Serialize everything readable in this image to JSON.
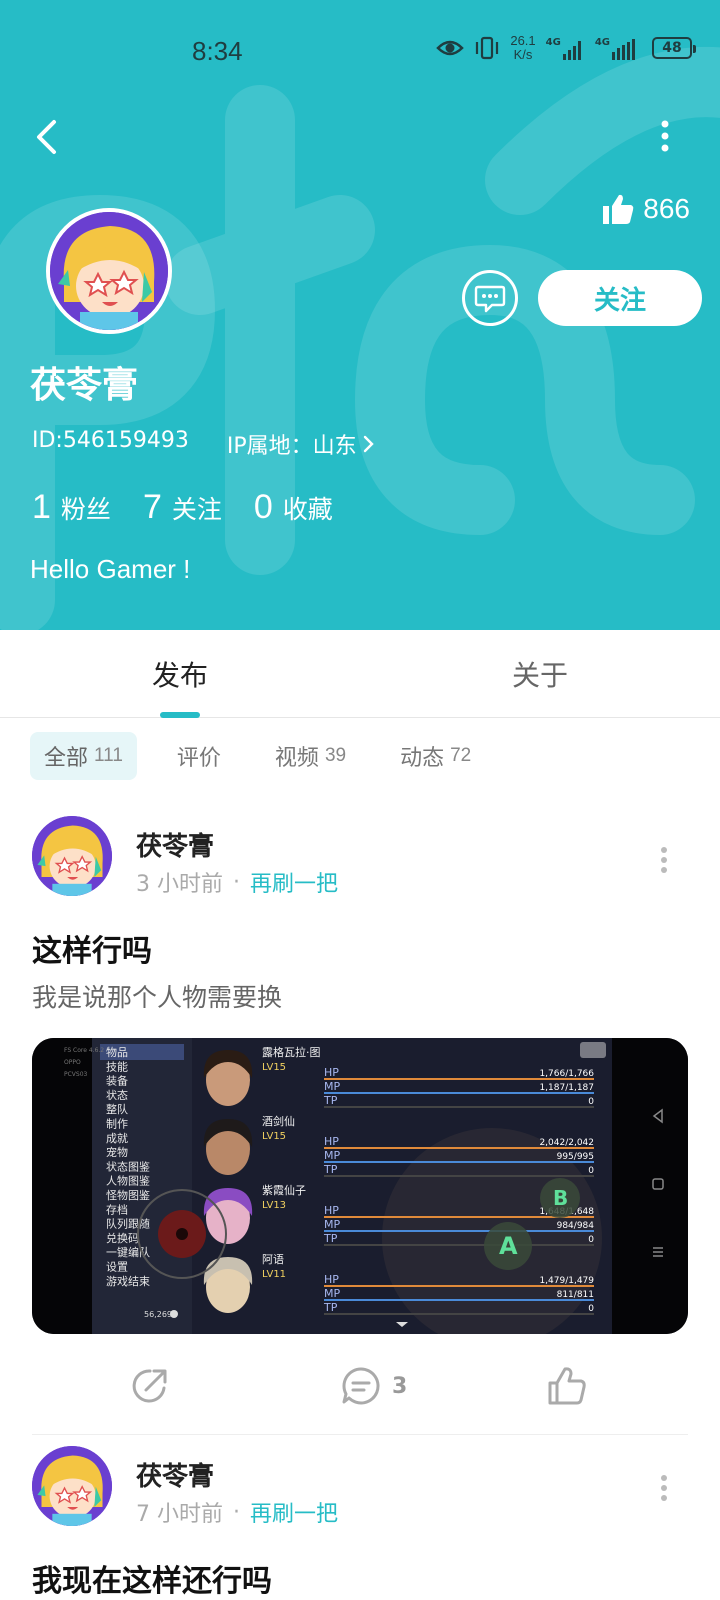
{
  "status_bar": {
    "time": "8:34",
    "speed_value": "26.1",
    "speed_unit": "K/s",
    "net1": "4G",
    "net2": "4G",
    "battery": "48"
  },
  "profile": {
    "likes": "866",
    "follow_label": "关注",
    "name": "茯苓膏",
    "id": "ID:546159493",
    "ip_label": "IP属地：山东",
    "fans_count": "1",
    "fans_label": "粉丝",
    "following_count": "7",
    "following_label": "关注",
    "fav_count": "0",
    "fav_label": "收藏",
    "bio": "Hello Gamer !"
  },
  "tabs": {
    "publish": "发布",
    "about": "关于"
  },
  "filters": [
    {
      "label": "全部",
      "count": "111"
    },
    {
      "label": "评价",
      "count": ""
    },
    {
      "label": "视频",
      "count": "39"
    },
    {
      "label": "动态",
      "count": "72"
    }
  ],
  "posts": [
    {
      "author": "茯苓膏",
      "time": "3 小时前",
      "game": "再刷一把",
      "title": "这样行吗",
      "body": "我是说那个人物需要换",
      "comments": "3"
    },
    {
      "author": "茯苓膏",
      "time": "7 小时前",
      "game": "再刷一把",
      "title": "我现在这样还行吗"
    }
  ],
  "game_screenshot": {
    "menu": [
      "物品",
      "技能",
      "装备",
      "状态",
      "整队",
      "制作",
      "成就",
      "宠物",
      "状态图鉴",
      "人物图鉴",
      "怪物图鉴",
      "存档",
      "队列跟随",
      "兑换码",
      "一键编队",
      "设置",
      "游戏结束"
    ],
    "gold": "56,269",
    "characters": [
      {
        "name": "露格瓦拉·图",
        "level": "LV15",
        "hp": "1,766/1,766",
        "mp": "1,187/1,187",
        "tp": "0",
        "hp_frac": 1.0,
        "mp_frac": 1.0
      },
      {
        "name": "酒剑仙",
        "level": "LV15",
        "hp": "2,042/2,042",
        "mp": "995/995",
        "tp": "0",
        "hp_frac": 1.0,
        "mp_frac": 1.0
      },
      {
        "name": "紫霞仙子",
        "level": "LV13",
        "hp": "1,648/1,648",
        "mp": "984/984",
        "tp": "0",
        "hp_frac": 1.0,
        "mp_frac": 1.0
      },
      {
        "name": "阿语",
        "level": "LV11",
        "hp": "1,479/1,479",
        "mp": "811/811",
        "tp": "0",
        "hp_frac": 1.0,
        "mp_frac": 1.0
      }
    ],
    "stat_labels": {
      "hp": "HP",
      "mp": "MP",
      "tp": "TP"
    },
    "button_a": "A",
    "button_b": "B",
    "corner_tags": [
      "FS Core 4.6.2",
      "OPPO",
      "PCVS03"
    ]
  },
  "icons": {
    "back": "chevron-left-icon",
    "more": "more-vertical-icon",
    "like": "thumbs-up-icon",
    "message": "chat-bubble-icon",
    "share": "share-icon",
    "comment": "comment-icon"
  },
  "colors": {
    "accent": "#26bcc6",
    "header_bg": "#26bcc6"
  }
}
